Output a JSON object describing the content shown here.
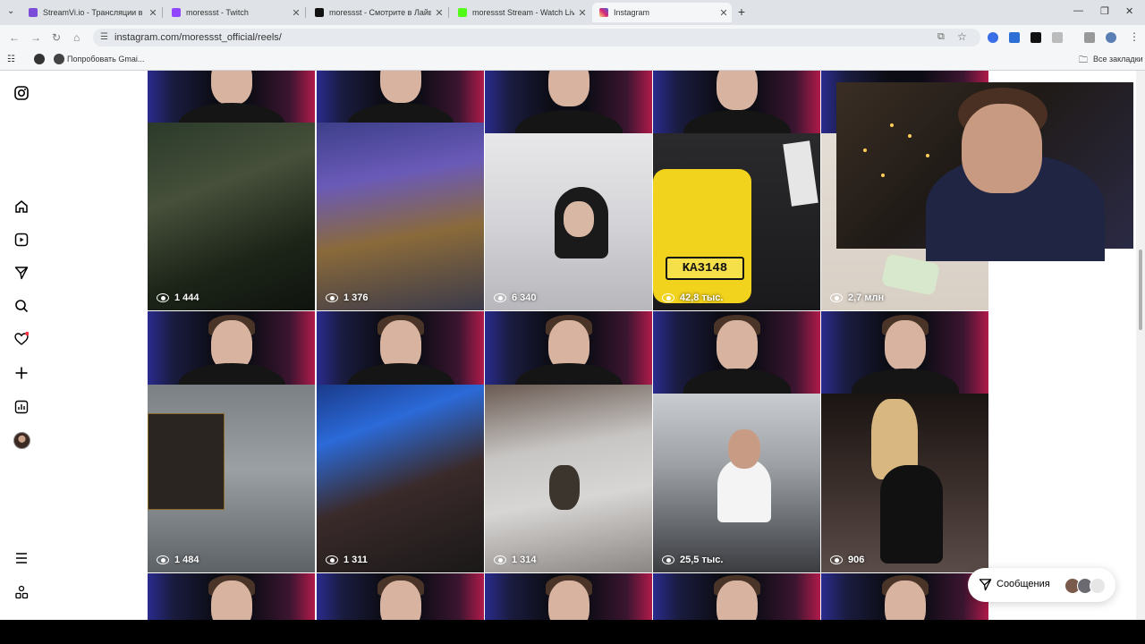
{
  "browser": {
    "tabs": [
      {
        "title": "StreamVi.io - Трансляции в не",
        "color": "#7b4dd8",
        "active": false
      },
      {
        "title": "moressst - Twitch",
        "color": "#9146ff",
        "active": false
      },
      {
        "title": "moressst - Смотрите в Лайве",
        "color": "#111111",
        "active": false
      },
      {
        "title": "moressst Stream - Watch Live",
        "color": "#53fc18",
        "active": false
      },
      {
        "title": "Instagram",
        "color": "#d6249f",
        "active": true
      }
    ],
    "new_tab_label": "+",
    "url": "instagram.com/moressst_official/reels/",
    "bookmarks": {
      "item": "Попробовать Gmai...",
      "all": "Все закладки"
    }
  },
  "sidebar": {
    "icons": [
      "instagram-icon",
      "home-icon",
      "reels-icon",
      "direct-icon",
      "search-icon",
      "heart-icon",
      "create-icon",
      "dashboard-icon",
      "profile-avatar",
      "menu-icon",
      "more-apps-icon"
    ]
  },
  "grid": {
    "row1_views": [
      "1 444",
      "1 376",
      "6 340",
      "42,8 тыс.",
      "2,7 млн"
    ],
    "row2_views": [
      "1 484",
      "1 311",
      "1 314",
      "25,5 тыс.",
      "906"
    ]
  },
  "video_overlay": {
    "plate": "KA3148"
  },
  "messages": {
    "label": "Сообщения"
  }
}
